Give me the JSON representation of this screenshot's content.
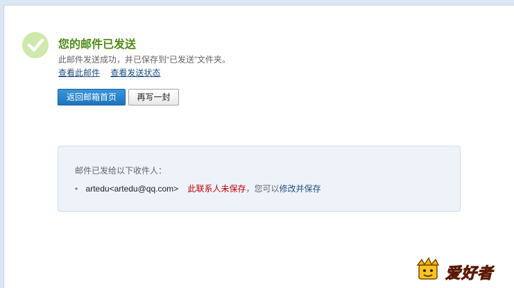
{
  "status": {
    "title": "您的邮件已发送",
    "description": "此邮件发送成功，并已保存到“已发送”文件夹。",
    "link_view_mail": "查看此邮件",
    "link_view_status": "查看发送状态"
  },
  "actions": {
    "back_to_inbox": "返回邮箱首页",
    "write_another": "再写一封"
  },
  "recipients": {
    "heading": "邮件已发给以下收件人：",
    "items": [
      {
        "address": "artedu<artedu@qq.com>",
        "unsaved_note": "此联系人未保存",
        "hint": "，您可以",
        "save_link": "修改并保存"
      }
    ]
  },
  "watermark": {
    "icon": "crown-mascot-icon",
    "text": "爱好者"
  },
  "colors": {
    "success_green": "#4f8a18",
    "check_bg": "#cfe9ad",
    "primary_button": "#1d73bd",
    "warning_red": "#c00000",
    "link_blue": "#1f4f86"
  }
}
